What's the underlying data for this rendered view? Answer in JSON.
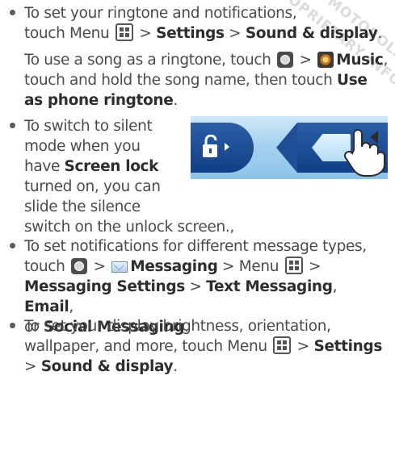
{
  "items": {
    "b1": {
      "line1": "To set your ringtone and notifications,",
      "line2_pre": "touch Menu ",
      "line2_mid": " > ",
      "line2_settings": "Settings",
      "line2_sep": " > ",
      "line2_sound": "Sound & display",
      "line2_end": "."
    },
    "b1sub": {
      "pre": "To use a song as a ringtone, touch ",
      "sep1": " > ",
      "music": "Music",
      "mid": ", touch and hold the song name, then touch ",
      "use_as": "Use as phone ringtone",
      "end": "."
    },
    "b2": {
      "l1": "To switch to silent",
      "l2": "mode when you",
      "l3_pre": "have ",
      "l3_bold": "Screen lock",
      "l4": "turned on, you can",
      "l5": "slide the silence",
      "l6": "switch on the unlock screen.,"
    },
    "b3": {
      "line1": "To set notifications for different message types,",
      "pre": "touch ",
      "sep1": " > ",
      "messaging": "Messaging",
      "sep2": " > Menu ",
      "sep3": " >",
      "msg_settings": "Messaging Settings",
      "sep4": " > ",
      "text_msg": "Text Messaging",
      "comma": ", ",
      "email": "Email",
      "comma2": ",",
      "or": "or ",
      "social": "Social Messaging",
      "end": "."
    },
    "b4": {
      "line1": "To set your display brightness, orientation,",
      "pre": "wallpaper, and more, touch Menu ",
      "sep1": " > ",
      "settings": "Settings",
      "sep2": "> ",
      "sound": "Sound & display",
      "end": "."
    }
  },
  "watermark": [
    "DRAFT - MOTOROLA CONFIDENTIAL",
    "& PROPRIETARY INFORMATION"
  ],
  "icons": [
    "menu-icon",
    "launcher-icon",
    "music-icon",
    "messaging-icon",
    "lock-icon",
    "arrow-right-icon",
    "speaker-mute-icon",
    "hand-pointer-icon"
  ]
}
